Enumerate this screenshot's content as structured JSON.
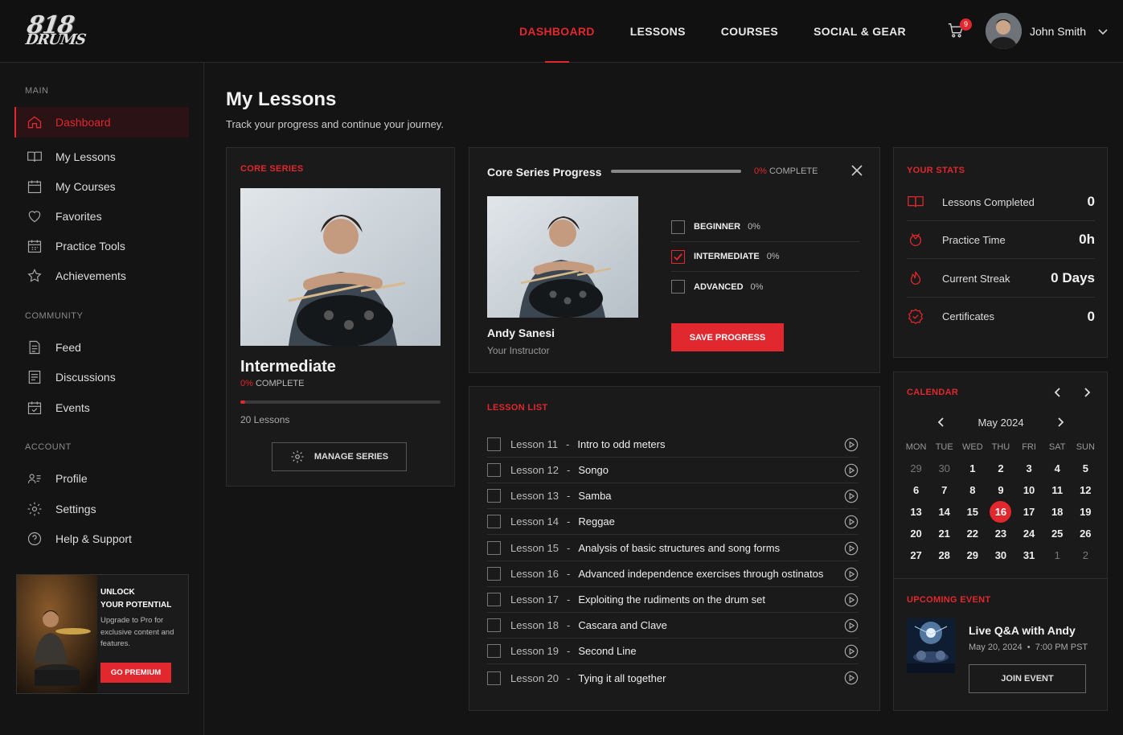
{
  "header": {
    "logo_line1": "818",
    "logo_line2": "DRUMS",
    "nav": [
      "DASHBOARD",
      "LESSONS",
      "COURSES",
      "SOCIAL & GEAR"
    ],
    "cart_count": "9",
    "user_name": "John Smith"
  },
  "sidebar": {
    "main_label": "MAIN",
    "main_items": [
      "Dashboard",
      "My Lessons",
      "My Courses",
      "Favorites",
      "Practice Tools",
      "Achievements"
    ],
    "community_label": "COMMUNITY",
    "community_items": [
      "Feed",
      "Discussions",
      "Events"
    ],
    "account_label": "ACCOUNT",
    "account_items": [
      "Profile",
      "Settings",
      "Help & Support"
    ],
    "promo": {
      "title1": "UNLOCK",
      "title2": "YOUR POTENTIAL",
      "text": "Upgrade to Pro for exclusive content and features.",
      "button": "GO PREMIUM"
    }
  },
  "page": {
    "title": "My Lessons",
    "subtitle": "Track your progress and continue your journey."
  },
  "core_series": {
    "label": "CORE SERIES",
    "title": "Intermediate",
    "pct": "0%",
    "complete": "COMPLETE",
    "progress": 0,
    "lessons": "20 Lessons",
    "manage": "MANAGE SERIES"
  },
  "progress_card": {
    "title": "Core Series Progress",
    "pct": "0%",
    "complete": "COMPLETE",
    "instructor_name": "Andy Sanesi",
    "instructor_role": "Your Instructor",
    "levels": [
      {
        "name": "BEGINNER",
        "pct": "0%",
        "checked": false
      },
      {
        "name": "INTERMEDIATE",
        "pct": "0%",
        "checked": true
      },
      {
        "name": "ADVANCED",
        "pct": "0%",
        "checked": false
      }
    ],
    "save": "SAVE PROGRESS"
  },
  "lesson_list": {
    "label": "LESSON LIST",
    "items": [
      {
        "num": "Lesson 11",
        "title": "Intro to odd meters"
      },
      {
        "num": "Lesson 12",
        "title": "Songo"
      },
      {
        "num": "Lesson 13",
        "title": "Samba"
      },
      {
        "num": "Lesson 14",
        "title": "Reggae"
      },
      {
        "num": "Lesson 15",
        "title": "Analysis of basic structures and song forms"
      },
      {
        "num": "Lesson 16",
        "title": "Advanced independence exercises through ostinatos"
      },
      {
        "num": "Lesson 17",
        "title": "Exploiting the rudiments on the drum set"
      },
      {
        "num": "Lesson 18",
        "title": "Cascara and Clave"
      },
      {
        "num": "Lesson 19",
        "title": "Second Line"
      },
      {
        "num": "Lesson 20",
        "title": "Tying it all together"
      }
    ]
  },
  "stats": {
    "label": "YOUR STATS",
    "items": [
      {
        "label": "Lessons Completed",
        "value": "0",
        "icon": "book-icon"
      },
      {
        "label": "Practice Time",
        "value": "0h",
        "icon": "drum-icon"
      },
      {
        "label": "Current Streak",
        "value": "0 Days",
        "icon": "flame-icon"
      },
      {
        "label": "Certificates",
        "value": "0",
        "icon": "badge-icon"
      }
    ]
  },
  "calendar": {
    "label": "CALENDAR",
    "month": "May 2024",
    "weekdays": [
      "MON",
      "TUE",
      "WED",
      "THU",
      "FRI",
      "SAT",
      "SUN"
    ],
    "weeks": [
      [
        "29",
        "30",
        "1",
        "2",
        "3",
        "4",
        "5"
      ],
      [
        "6",
        "7",
        "8",
        "9",
        "10",
        "11",
        "12"
      ],
      [
        "13",
        "14",
        "15",
        "16",
        "17",
        "18",
        "19"
      ],
      [
        "20",
        "21",
        "22",
        "23",
        "24",
        "25",
        "26"
      ],
      [
        "27",
        "28",
        "29",
        "30",
        "31",
        "1",
        "2"
      ]
    ],
    "today": "16"
  },
  "event": {
    "label": "UPCOMING EVENT",
    "title": "Live Q&A with Andy",
    "date": "May 20, 2024",
    "time": "7:00 PM PST",
    "button": "JOIN EVENT"
  },
  "colors": {
    "accent": "#e0282e",
    "background": "#141414",
    "card": "#1a1a1a"
  }
}
